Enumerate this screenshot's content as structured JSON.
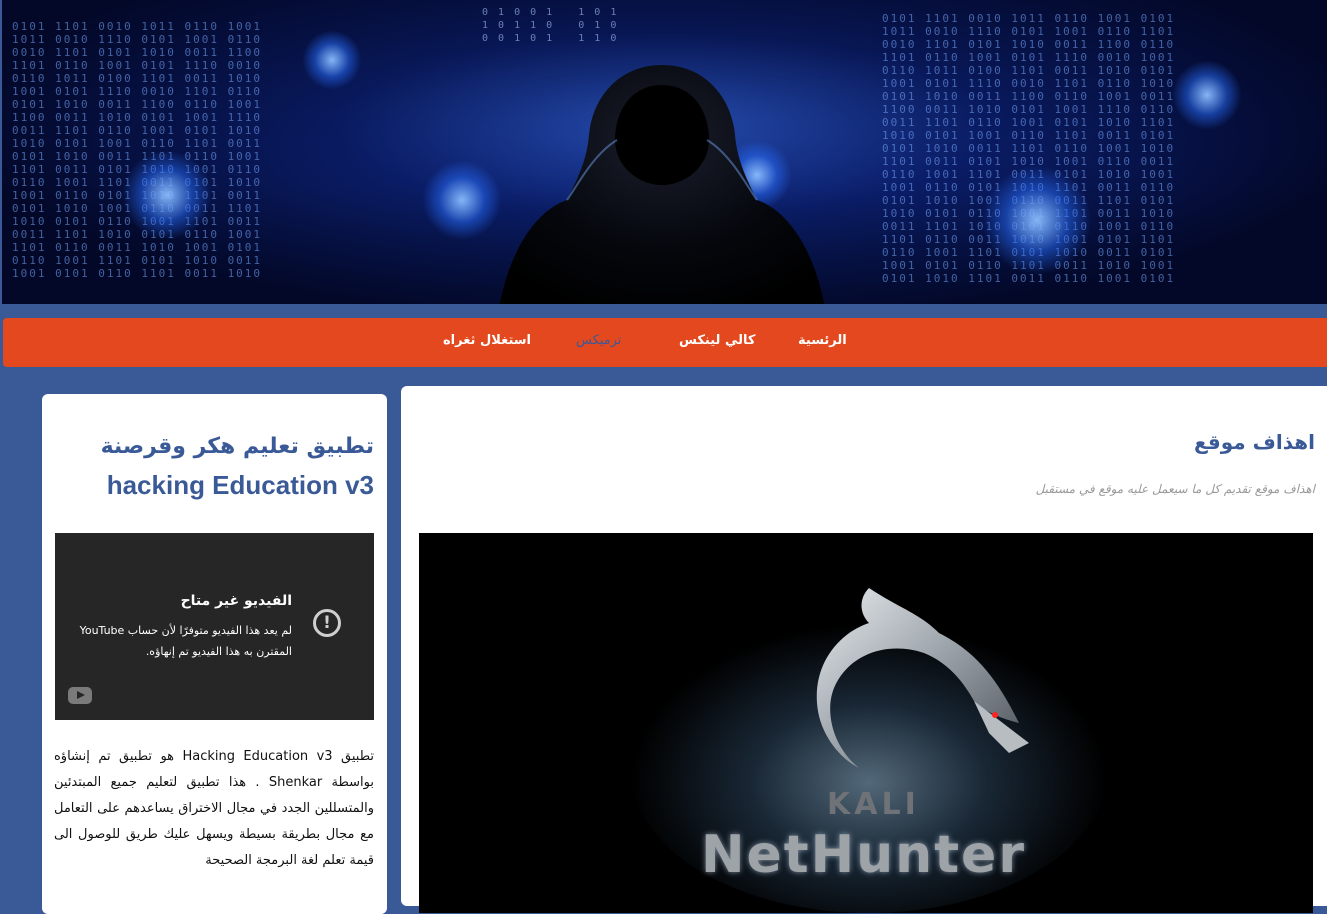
{
  "nav": {
    "items": [
      {
        "label": "الرئسية"
      },
      {
        "label": "كالي لينكس"
      },
      {
        "label": "ترميكس"
      },
      {
        "label": "استغلال ثغراه"
      }
    ]
  },
  "sidebar": {
    "title_ar": "تطبيق تعليم هكر وقرصنة",
    "title_en": "hacking Education v3",
    "video": {
      "error_title": "الفيديو غير متاح",
      "error_body": "لم يعد هذا الفيديو متوفرًا لأن حساب YouTube المقترن به هذا الفيديو تم إنهاؤه.",
      "error_icon": "!"
    },
    "description": "تطبيق Hacking Education v3 هو تطبيق تم إنشاؤه بواسطة Shenkar . هذا تطبيق لتعليم جميع المبتدئين والمتسللين الجدد في مجال الاختراق يساعدهم على التعامل مع مجال بطريقة بسيطة ويسهل عليك طريق للوصول الى قيمة تعلم لغة البرمجة الصحيحة"
  },
  "post": {
    "title": "اهذاف موقع",
    "subtitle": "اهذاف موقع تقديم كل ما سيعمل عليه موقع في مستقبل",
    "image": {
      "logo_top": "KALI",
      "logo_bottom": "NetHunter"
    }
  },
  "colors": {
    "page_bg": "#3a5a97",
    "nav_bg": "#e4481e",
    "accent": "#3a5a97"
  }
}
